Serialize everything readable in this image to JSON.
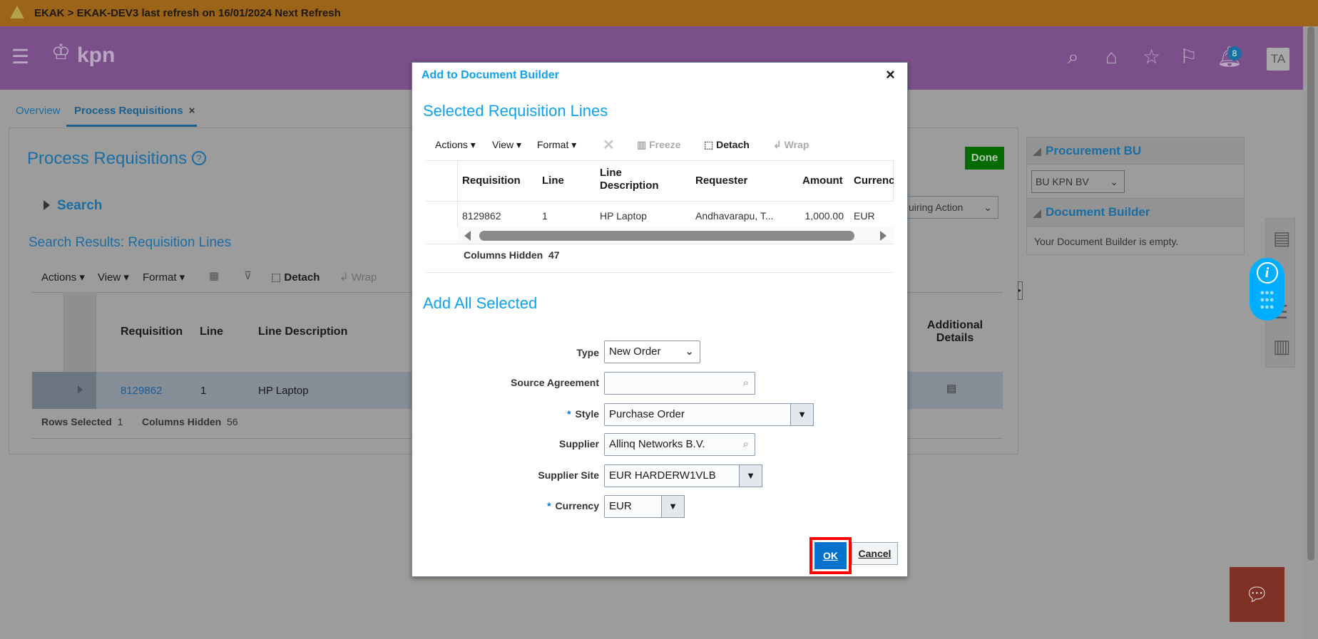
{
  "banner": {
    "text": "EKAK > EKAK-DEV3 last refresh on 16/01/2024 Next Refresh",
    "icon": "warning-icon"
  },
  "header": {
    "logo": "kpn",
    "notifications_count": "8",
    "avatar": "TA",
    "colors": {
      "header": "#7b4f89",
      "banner": "#9c6418"
    }
  },
  "tabs": [
    {
      "label": "Overview"
    },
    {
      "label": "Process Requisitions",
      "close": "×"
    }
  ],
  "page": {
    "title": "Process Requisitions",
    "search_label": "Search",
    "results_title": "Search Results: Requisition Lines",
    "toolbar": {
      "actions": "Actions",
      "view": "View",
      "format": "Format",
      "detach": "Detach",
      "wrap": "Wrap"
    },
    "columns": [
      "Requisition",
      "Line",
      "Line Description",
      "Additional Details"
    ],
    "rows": [
      {
        "requisition": "8129862",
        "line": "1",
        "description": "HP Laptop"
      }
    ],
    "footer": {
      "rows_selected_label": "Rows Selected",
      "rows_selected": "1",
      "columns_hidden_label": "Columns Hidden",
      "columns_hidden": "56"
    },
    "done": "Done",
    "filter_select": "uiring Action"
  },
  "side_panel": {
    "procurement_bu_title": "Procurement BU",
    "bu_value": "BU KPN BV",
    "doc_builder_title": "Document Builder",
    "doc_builder_empty": "Your Document Builder is empty."
  },
  "dialog": {
    "title": "Add to Document Builder",
    "close": "×",
    "section1": "Selected Requisition Lines",
    "toolbar": {
      "actions": "Actions",
      "view": "View",
      "format": "Format",
      "freeze": "Freeze",
      "detach": "Detach",
      "wrap": "Wrap"
    },
    "columns": [
      "Requisition",
      "Line",
      "Line Description",
      "Requester",
      "Amount",
      "Currenc"
    ],
    "rows": [
      {
        "requisition": "8129862",
        "line": "1",
        "description": "HP Laptop",
        "requester": "Andhavarapu, T...",
        "amount": "1,000.00",
        "currency": "EUR"
      }
    ],
    "columns_hidden_label": "Columns Hidden",
    "columns_hidden": "47",
    "section2": "Add All Selected",
    "form": {
      "type": {
        "label": "Type",
        "value": "New Order"
      },
      "source_agreement": {
        "label": "Source Agreement",
        "value": ""
      },
      "style": {
        "label": "Style",
        "value": "Purchase Order",
        "required": "*"
      },
      "supplier": {
        "label": "Supplier",
        "value": "Allinq Networks B.V."
      },
      "supplier_site": {
        "label": "Supplier Site",
        "value": "EUR HARDERW1VLB"
      },
      "currency": {
        "label": "Currency",
        "value": "EUR",
        "required": "*"
      }
    },
    "ok": "OK",
    "cancel": "Cancel"
  }
}
